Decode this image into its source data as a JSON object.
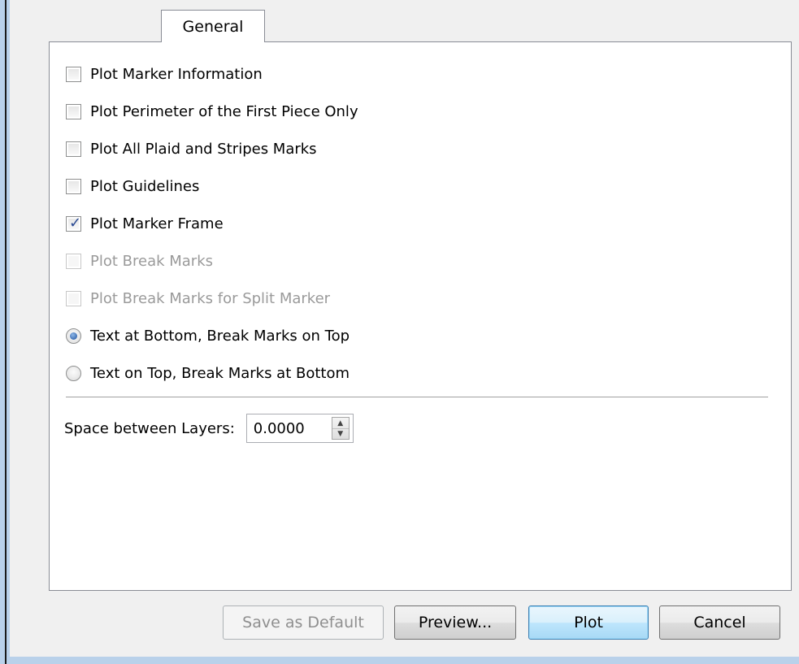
{
  "tabs": [
    {
      "label": "General",
      "selected": true
    }
  ],
  "options": {
    "checkboxes": [
      {
        "label": "Plot Marker Information",
        "checked": false,
        "enabled": true
      },
      {
        "label": "Plot Perimeter of the First Piece Only",
        "checked": false,
        "enabled": true
      },
      {
        "label": "Plot All Plaid and Stripes Marks",
        "checked": false,
        "enabled": true
      },
      {
        "label": "Plot Guidelines",
        "checked": false,
        "enabled": true
      },
      {
        "label": "Plot Marker Frame",
        "checked": true,
        "enabled": true
      },
      {
        "label": "Plot Break Marks",
        "checked": false,
        "enabled": false
      },
      {
        "label": "Plot Break Marks for Split Marker",
        "checked": false,
        "enabled": false
      }
    ],
    "radios": [
      {
        "label": "Text at Bottom, Break Marks on Top",
        "selected": true
      },
      {
        "label": "Text on Top, Break Marks at Bottom",
        "selected": false
      }
    ]
  },
  "space_between_layers": {
    "label": "Space between Layers:",
    "value": "0.0000"
  },
  "buttons": {
    "save_default": "Save as Default",
    "preview": "Preview...",
    "plot": "Plot",
    "cancel": "Cancel"
  },
  "icons": {
    "check": "checkmark-icon",
    "spin_up": "up-arrow-icon",
    "spin_down": "down-arrow-icon"
  }
}
